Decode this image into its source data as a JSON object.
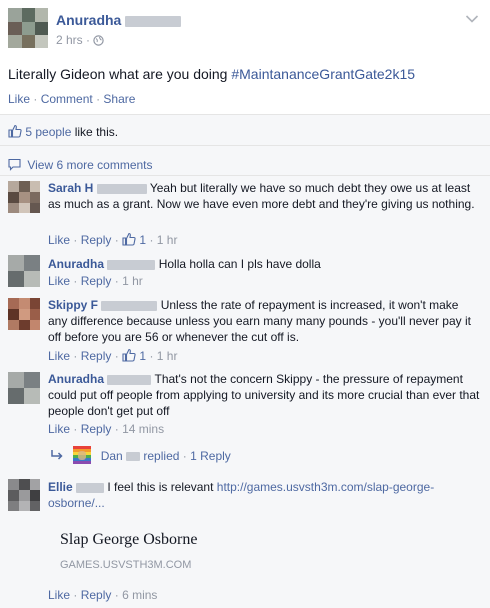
{
  "post": {
    "author": "Anuradha",
    "time": "2 hrs",
    "body_plain": "Literally Gideon what are you doing ",
    "hashtag": "#MaintananceGrantGate2k15",
    "actions": [
      "Like",
      "Comment",
      "Share"
    ],
    "likes_count": "5 people",
    "likes_suffix": " like this.",
    "view_more": "View 6 more comments"
  },
  "comments": [
    {
      "author": "Sarah H",
      "text": "Yeah but literally we have so much debt they owe us at least as much as a grant. Now we have even more debt and they're giving us nothing.",
      "like": "Like",
      "reply": "Reply",
      "likes": "1",
      "time": "1 hr"
    },
    {
      "author": "Anuradha",
      "text": "Holla holla can I pls have dolla",
      "like": "Like",
      "reply": "Reply",
      "time": "1 hr"
    },
    {
      "author": "Skippy F",
      "text": "Unless the rate of repayment is increased, it won't make any difference because unless you earn many many pounds - you'll never pay it off before you are 56 or whenever the cut off is.",
      "like": "Like",
      "reply": "Reply",
      "likes": "1",
      "time": "1 hr"
    },
    {
      "author": "Anuradha",
      "text": "That's not the concern Skippy - the pressure of repayment could put off people from applying to university and its more crucial than ever that people don't get put off",
      "like": "Like",
      "reply": "Reply",
      "time": "14 mins",
      "replies": {
        "name": "Dan",
        "replied": "replied",
        "count": "1 Reply"
      }
    },
    {
      "author": "Ellie",
      "text_plain": "I feel this is relevant ",
      "link": "http://games.usvsth3m.com/slap-george-osborne/...",
      "preview_title": "Slap George Osborne",
      "preview_domain": "GAMES.USVSTH3M.COM",
      "like": "Like",
      "reply": "Reply",
      "time": "6 mins"
    }
  ],
  "colors": {
    "link": "#4e69a2",
    "name": "#3b5998",
    "hashtag": "#3b5998",
    "meta_gray": "#9197a3",
    "comment_bg": "#f6f7f9"
  }
}
